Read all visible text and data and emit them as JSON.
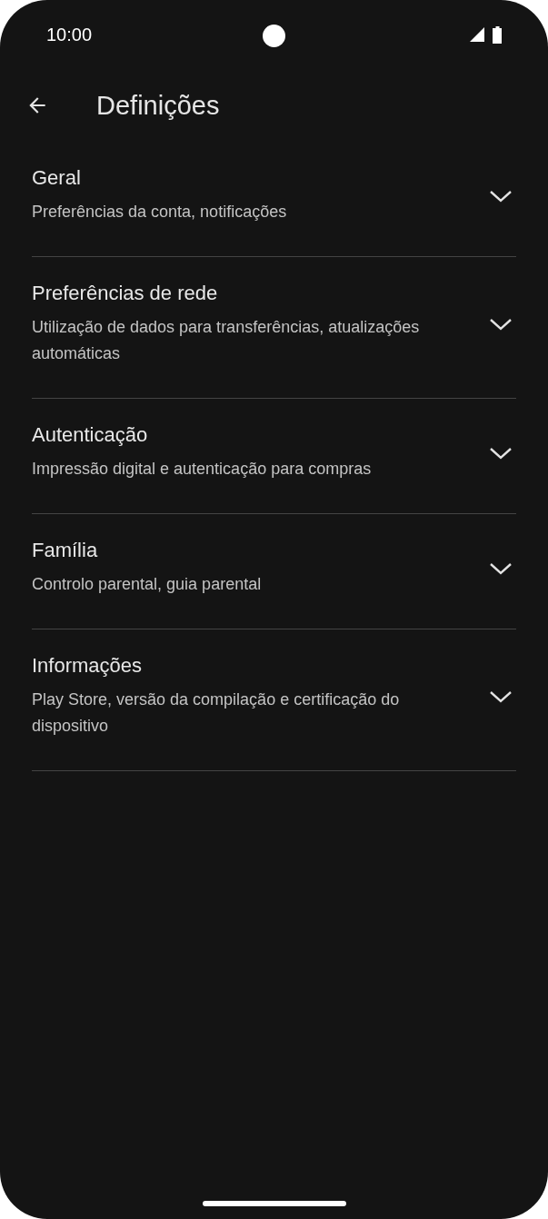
{
  "status_bar": {
    "time": "10:00"
  },
  "header": {
    "title": "Definições"
  },
  "sections": [
    {
      "title": "Geral",
      "subtitle": "Preferências da conta, notificações",
      "expanded": false
    },
    {
      "title": "Preferências de rede",
      "subtitle": "Utilização de dados para transferências, atualizações automáticas",
      "expanded": false
    },
    {
      "title": "Autenticação",
      "subtitle": "Impressão digital e autenticação para compras",
      "expanded": false
    },
    {
      "title": "Família",
      "subtitle": "Controlo parental, guia parental",
      "expanded": false
    },
    {
      "title": "Informações",
      "subtitle": "Play Store, versão da compilação e certificação do dispositivo",
      "expanded": false
    }
  ]
}
